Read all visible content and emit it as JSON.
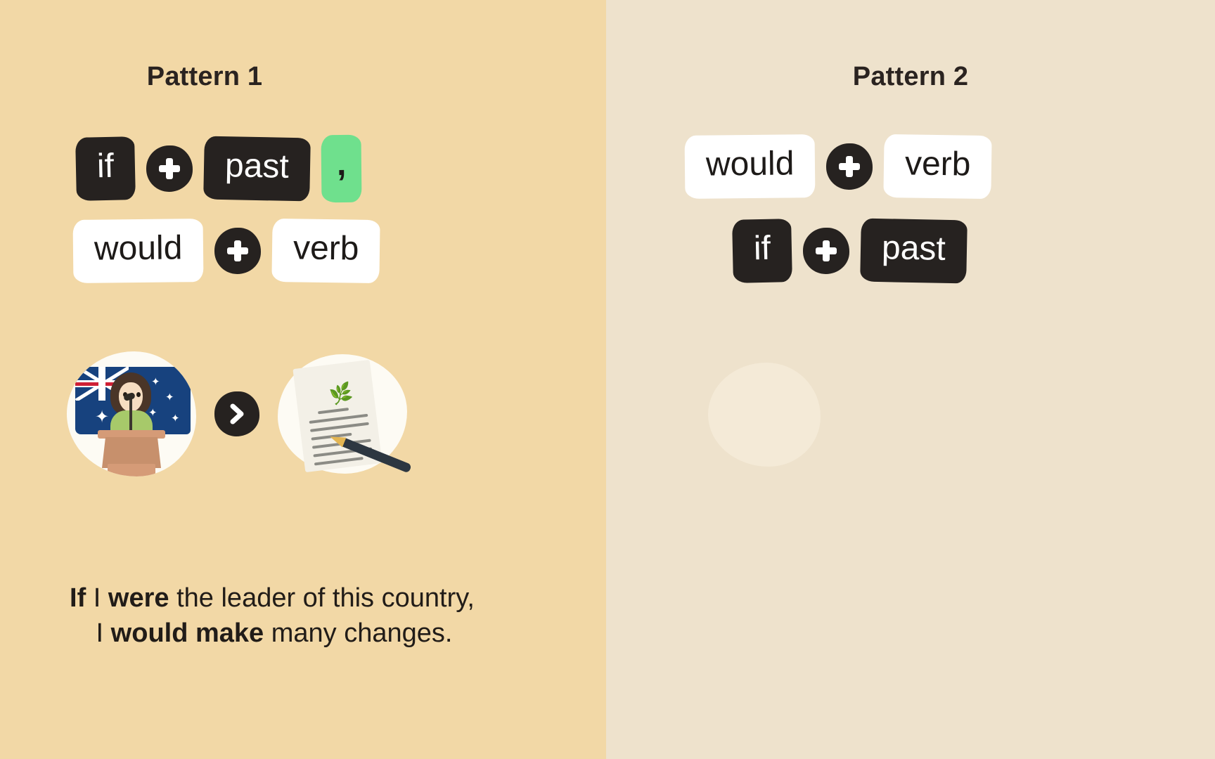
{
  "colors": {
    "left_panel_bg": "#f2d8a6",
    "right_panel_bg": "#eee2cc",
    "chip_dark_bg": "#262220",
    "chip_light_bg": "#ffffff",
    "chip_green_bg": "#6fe08d",
    "text_dark": "#211c18"
  },
  "left_panel": {
    "title": "Pattern 1",
    "formula_row_1": {
      "chip_1": "if",
      "operator": "+",
      "chip_2": "past",
      "chip_3": ","
    },
    "formula_row_2": {
      "chip_1": "would",
      "operator": "+",
      "chip_2": "verb"
    },
    "illustration": {
      "first_icon": "speaker-at-podium-with-australian-flag-icon",
      "arrow_icon": "chevron-right-icon",
      "second_icon": "policy-document-with-leaf-and-pen-icon",
      "flag_stars": [
        "✦",
        "✦",
        "✦",
        "✦",
        "✦"
      ]
    },
    "example_sentence": {
      "line_1_parts": [
        {
          "text": "If",
          "bold": true
        },
        {
          "text": " I ",
          "bold": false
        },
        {
          "text": "were",
          "bold": true
        },
        {
          "text": " the leader of this country,",
          "bold": false
        }
      ],
      "line_2_parts": [
        {
          "text": "I ",
          "bold": false
        },
        {
          "text": "would make",
          "bold": true
        },
        {
          "text": " many changes.",
          "bold": false
        }
      ],
      "line_1_plain": "If I were the leader of this country,",
      "line_2_plain": "I would make many changes."
    }
  },
  "right_panel": {
    "title": "Pattern 2",
    "formula_row_1": {
      "chip_1": "would",
      "operator": "+",
      "chip_2": "verb"
    },
    "formula_row_2": {
      "chip_1": "if",
      "operator": "+",
      "chip_2": "past"
    },
    "illustration": {
      "placeholder_icon": "empty-illustration-placeholder"
    }
  }
}
